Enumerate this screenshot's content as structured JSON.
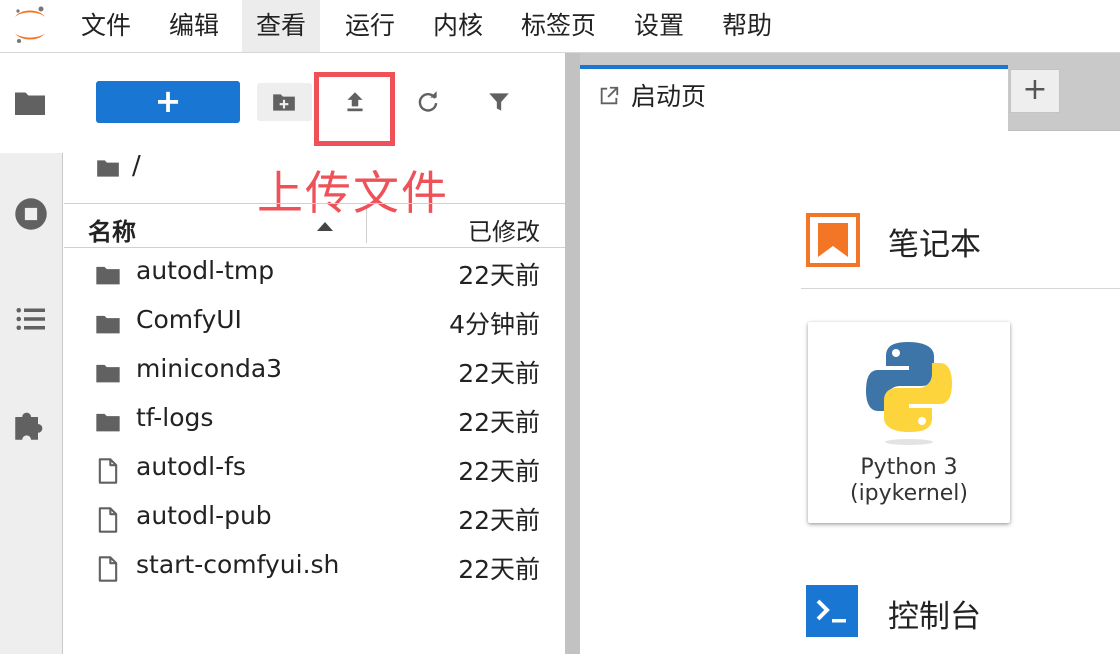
{
  "menubar": {
    "items": [
      "文件",
      "编辑",
      "查看",
      "运行",
      "内核",
      "标签页",
      "设置",
      "帮助"
    ],
    "active_index": 2
  },
  "activity_bar": {
    "icons": [
      "folder-icon",
      "stop-circle-icon",
      "list-icon",
      "puzzle-icon"
    ]
  },
  "filebrowser": {
    "new_button_label": "+",
    "annotation": "上传文件",
    "breadcrumb": "/",
    "columns": {
      "name": "名称",
      "modified": "已修改"
    },
    "rows": [
      {
        "type": "folder",
        "name": "autodl-tmp",
        "modified": "22天前"
      },
      {
        "type": "folder",
        "name": "ComfyUI",
        "modified": "4分钟前"
      },
      {
        "type": "folder",
        "name": "miniconda3",
        "modified": "22天前"
      },
      {
        "type": "folder",
        "name": "tf-logs",
        "modified": "22天前"
      },
      {
        "type": "file",
        "name": "autodl-fs",
        "modified": "22天前"
      },
      {
        "type": "file",
        "name": "autodl-pub",
        "modified": "22天前"
      },
      {
        "type": "file",
        "name": "start-comfyui.sh",
        "modified": "22天前"
      }
    ]
  },
  "main": {
    "tabs": [
      {
        "label": "启动页"
      }
    ],
    "add_tab_label": "+",
    "notebook_section": "笔记本",
    "kernel": {
      "name": "Python 3",
      "subname": "(ipykernel)"
    },
    "console_section": "控制台"
  },
  "colors": {
    "accent": "#1976d2",
    "annotation": "#ef5158",
    "notebook_orange": "#f37626"
  }
}
